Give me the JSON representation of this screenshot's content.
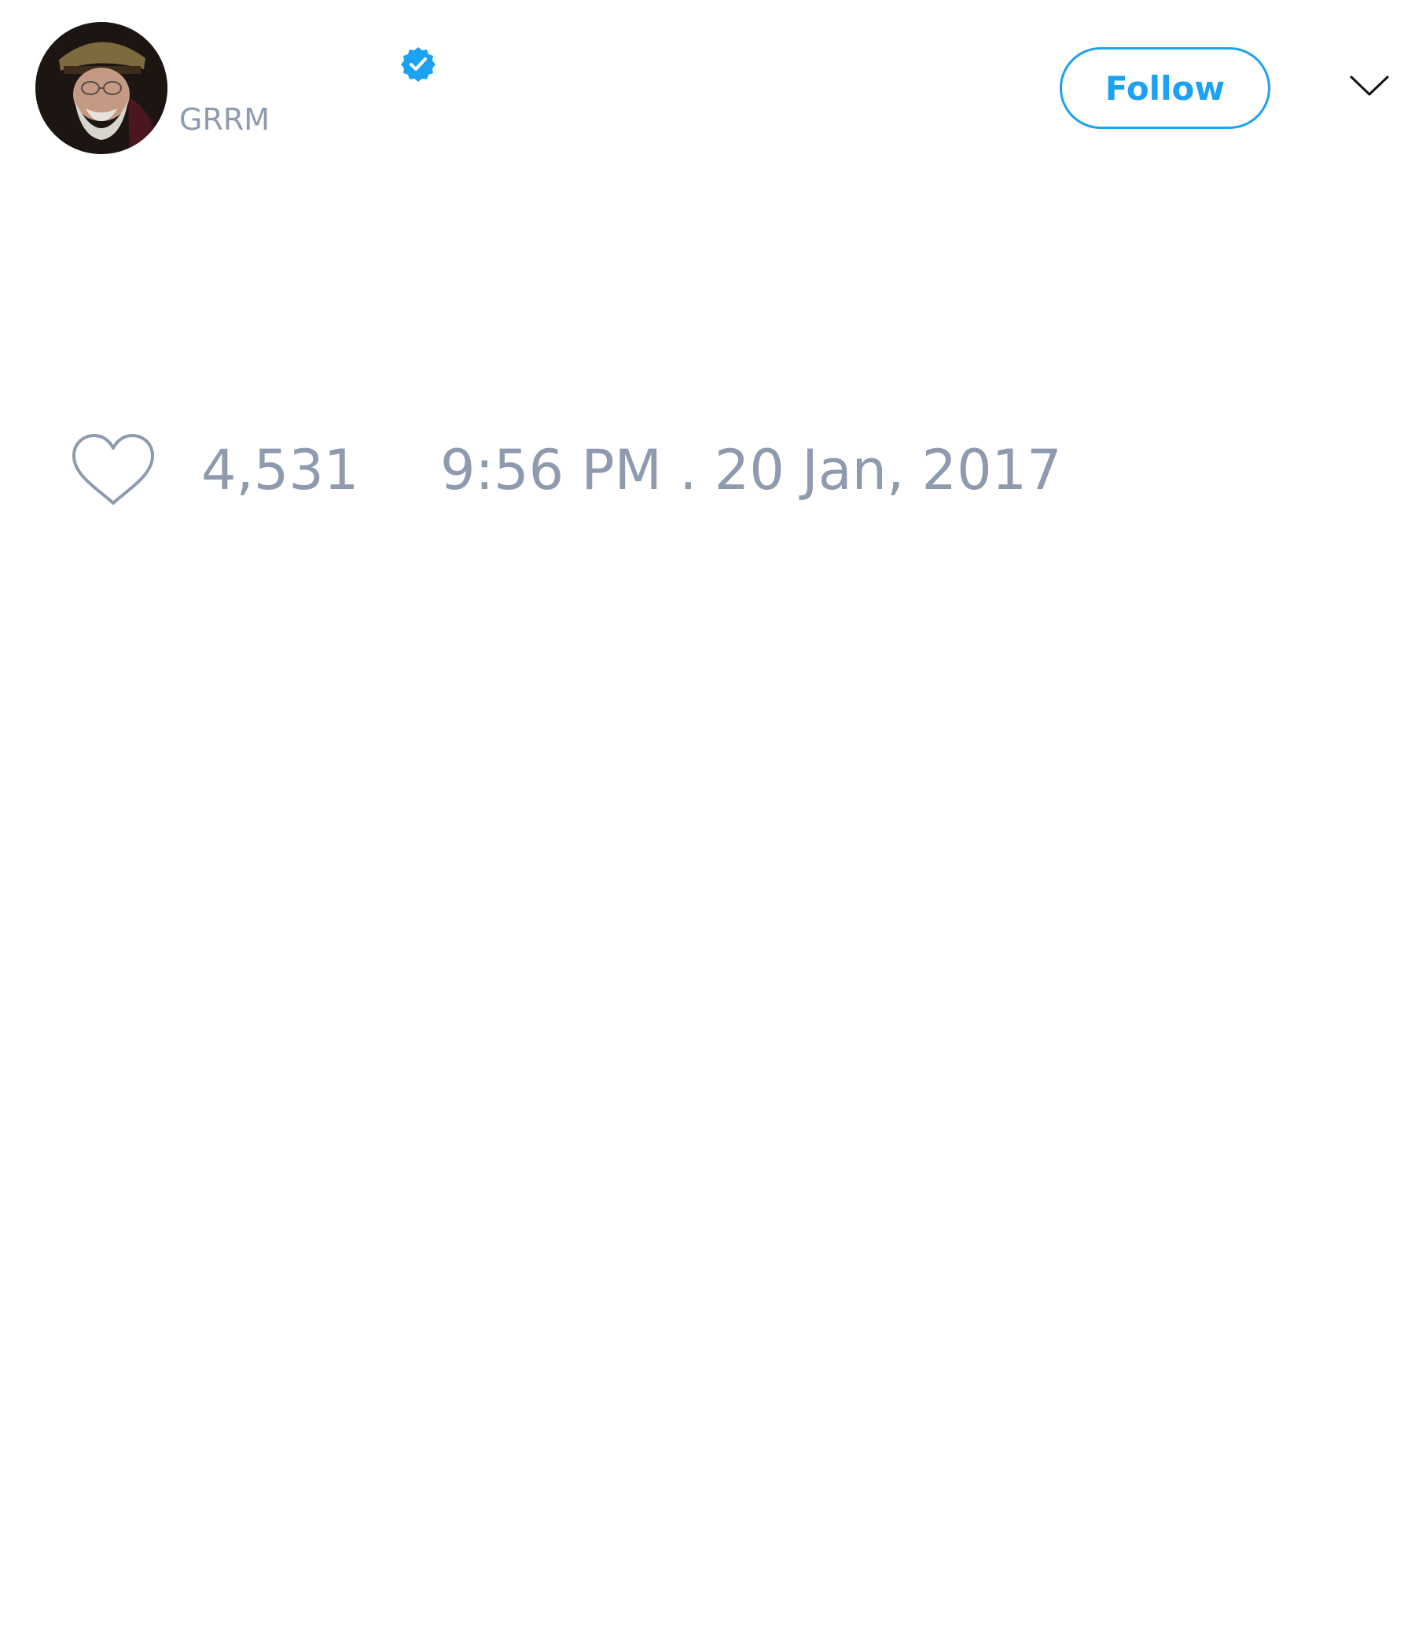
{
  "header": {
    "display_name": "",
    "handle": "GRRM",
    "follow_label": "Follow",
    "avatar_icon": "profile-photo",
    "verified_icon": "verified-badge-icon",
    "more_icon": "chevron-down-icon"
  },
  "footer": {
    "like_icon": "heart-icon",
    "like_count": "4,531",
    "timestamp": "9:56 PM . 20 Jan, 2017"
  },
  "colors": {
    "accent": "#1da1f2",
    "secondary_text": "#8e9bae",
    "icon_stroke": "#8e9bae",
    "background": "#ffffff"
  }
}
